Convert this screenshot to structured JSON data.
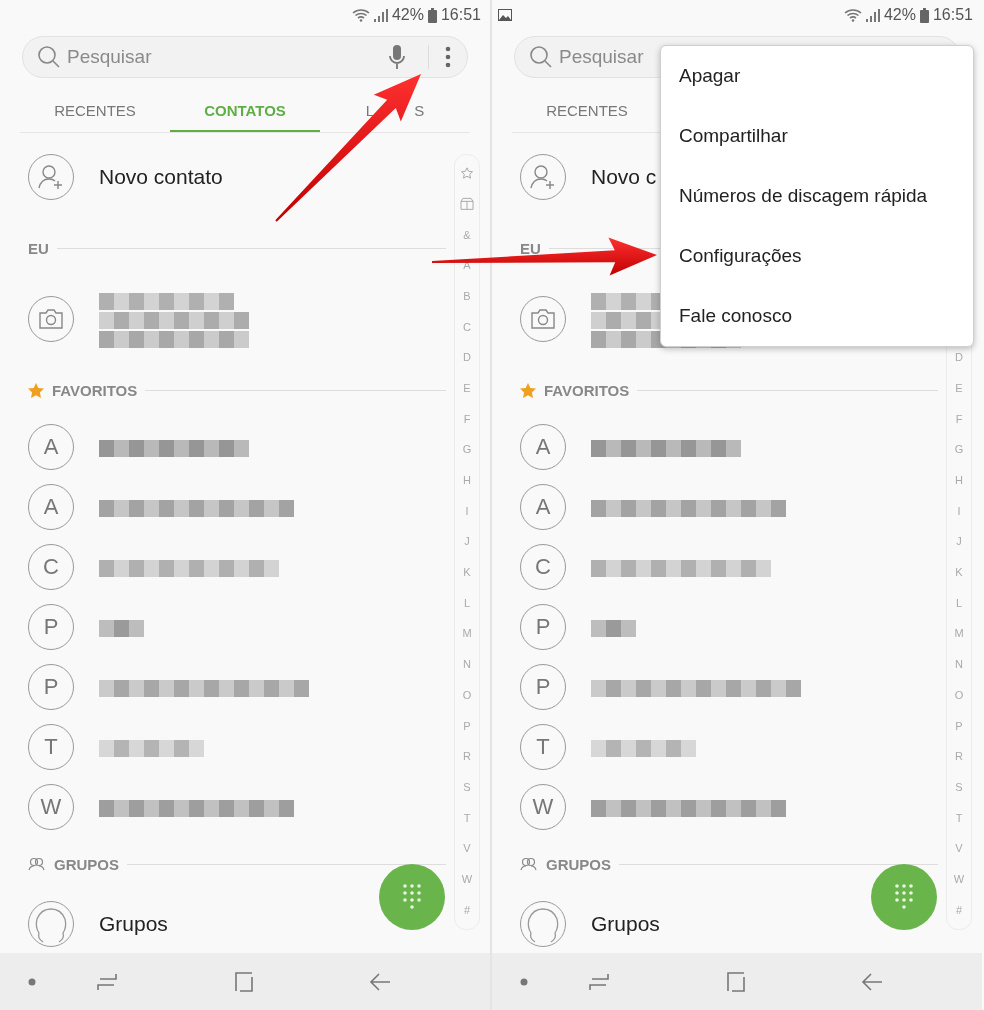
{
  "screens": [
    {
      "status_bar": {
        "battery": "42%",
        "time": "16:51"
      },
      "search": {
        "placeholder": "Pesquisar",
        "actions": [
          {
            "kind": "mic"
          },
          {
            "kind": "more"
          }
        ]
      },
      "tabs": [
        {
          "label": "RECENTES",
          "selected": false
        },
        {
          "label": "CONTATOS",
          "selected": true
        },
        {
          "label_parts": [
            "L",
            "S"
          ],
          "selected": false
        }
      ],
      "new_contact": "Novo contato",
      "rows": [
        {
          "kind": "header",
          "title": "EU"
        },
        {
          "kind": "me"
        },
        {
          "kind": "favorites_header",
          "title": "FAVORITOS"
        },
        {
          "kind": "contact",
          "initial": "A"
        },
        {
          "kind": "contact",
          "initial": "A"
        },
        {
          "kind": "contact",
          "initial": "C"
        },
        {
          "kind": "contact",
          "initial": "P"
        },
        {
          "kind": "contact",
          "initial": "P"
        },
        {
          "kind": "contact",
          "initial": "T"
        },
        {
          "kind": "contact",
          "initial": "W"
        },
        {
          "kind": "groups_header",
          "title": "GRUPOS"
        },
        {
          "kind": "group",
          "name": "Grupos"
        }
      ],
      "index_marks": [
        {
          "kind": "star"
        },
        {
          "kind": "book"
        }
      ],
      "index_letters": [
        "&",
        "A",
        "B",
        "C",
        "D",
        "E",
        "F",
        "G",
        "H",
        "I",
        "J",
        "K",
        "L",
        "M",
        "N",
        "O",
        "P",
        "R",
        "S",
        "T",
        "V",
        "W",
        "#"
      ]
    },
    {
      "status_bar": {
        "notifications": [
          {
            "kind": "image"
          }
        ],
        "battery": "42%",
        "time": "16:51"
      },
      "search": {
        "placeholder": "Pesquisar"
      },
      "tabs": [
        {
          "label": "RECENTES",
          "selected": false
        }
      ],
      "new_contact": "Novo c",
      "rows": [
        {
          "kind": "header",
          "title": "EU"
        },
        {
          "kind": "me"
        },
        {
          "kind": "favorites_header",
          "title": "FAVORITOS"
        },
        {
          "kind": "contact",
          "initial": "A"
        },
        {
          "kind": "contact",
          "initial": "A"
        },
        {
          "kind": "contact",
          "initial": "C"
        },
        {
          "kind": "contact",
          "initial": "P"
        },
        {
          "kind": "contact",
          "initial": "P"
        },
        {
          "kind": "contact",
          "initial": "T"
        },
        {
          "kind": "contact",
          "initial": "W"
        },
        {
          "kind": "groups_header",
          "title": "GRUPOS"
        },
        {
          "kind": "group",
          "name": "Grupos"
        }
      ],
      "index_letters": [
        "D",
        "E",
        "F",
        "G",
        "H",
        "I",
        "J",
        "K",
        "L",
        "M",
        "N",
        "O",
        "P",
        "R",
        "S",
        "T",
        "V",
        "W",
        "#"
      ],
      "menu": {
        "items": [
          "Apagar",
          "Compartilhar",
          "Números de discagem rápida",
          "Configurações",
          "Fale conosco"
        ]
      }
    }
  ]
}
